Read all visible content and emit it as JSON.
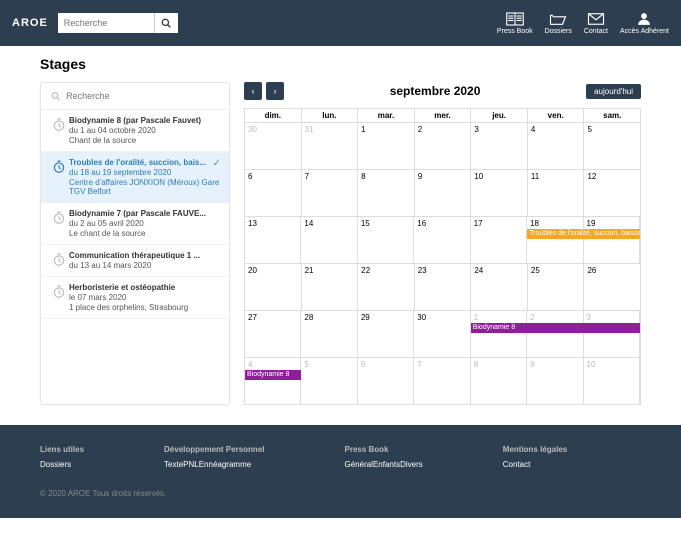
{
  "header": {
    "logo": "AROE",
    "search_placeholder": "Recherche",
    "nav": [
      {
        "label": "Press Book"
      },
      {
        "label": "Dossiers"
      },
      {
        "label": "Contact"
      },
      {
        "label": "Accès Adhérent"
      }
    ]
  },
  "page_title": "Stages",
  "side_search_placeholder": "Recherche",
  "events": [
    {
      "title": "Biodynamie 8 (par Pascale Fauvet)",
      "date": "du 1 au 04 octobre 2020",
      "loc": "Chant de la source",
      "sel": false
    },
    {
      "title": "Troubles de l'oralité, succion, bais...",
      "date": "du 18 au 19 septembre 2020",
      "loc": "Centre d'affaires JONXION (Méroux) Gare TGV Belfort",
      "sel": true
    },
    {
      "title": "Biodynamie 7 (par Pascale FAUVE...",
      "date": "du 2 au 05 avril 2020",
      "loc": "Le chant de la source",
      "sel": false
    },
    {
      "title": "Communication thérapeutique 1 ...",
      "date": "du 13 au 14 mars 2020",
      "loc": "",
      "sel": false
    },
    {
      "title": "Herboristerie et ostéopathie",
      "date": "le 07 mars 2020",
      "loc": "1 place des orphelins, Strasbourg",
      "sel": false
    }
  ],
  "calendar": {
    "title": "septembre 2020",
    "today_label": "aujourd'hui",
    "dow": [
      "dim.",
      "lun.",
      "mar.",
      "mer.",
      "jeu.",
      "ven.",
      "sam."
    ],
    "weeks": [
      [
        {
          "n": "30",
          "o": true
        },
        {
          "n": "31",
          "o": true
        },
        {
          "n": "1"
        },
        {
          "n": "2"
        },
        {
          "n": "3"
        },
        {
          "n": "4"
        },
        {
          "n": "5"
        }
      ],
      [
        {
          "n": "6"
        },
        {
          "n": "7"
        },
        {
          "n": "8"
        },
        {
          "n": "9"
        },
        {
          "n": "10"
        },
        {
          "n": "11"
        },
        {
          "n": "12"
        }
      ],
      [
        {
          "n": "13"
        },
        {
          "n": "14"
        },
        {
          "n": "15"
        },
        {
          "n": "16"
        },
        {
          "n": "17"
        },
        {
          "n": "18"
        },
        {
          "n": "19"
        }
      ],
      [
        {
          "n": "20"
        },
        {
          "n": "21"
        },
        {
          "n": "22"
        },
        {
          "n": "23"
        },
        {
          "n": "24"
        },
        {
          "n": "25"
        },
        {
          "n": "26"
        }
      ],
      [
        {
          "n": "27"
        },
        {
          "n": "28"
        },
        {
          "n": "29"
        },
        {
          "n": "30"
        },
        {
          "n": "1",
          "o": true
        },
        {
          "n": "2",
          "o": true
        },
        {
          "n": "3",
          "o": true
        }
      ],
      [
        {
          "n": "4",
          "o": true
        },
        {
          "n": "5",
          "o": true
        },
        {
          "n": "6",
          "o": true
        },
        {
          "n": "7",
          "o": true
        },
        {
          "n": "8",
          "o": true
        },
        {
          "n": "9",
          "o": true
        },
        {
          "n": "10",
          "o": true
        }
      ]
    ],
    "bars": [
      {
        "week": 2,
        "start": 5,
        "span": 2,
        "color": "#f5a623",
        "text": "Troubles de l'oralité, succion, baisse ou"
      },
      {
        "week": 4,
        "start": 4,
        "span": 3,
        "color": "#8e1e9a",
        "text": "Biodynamie 8"
      },
      {
        "week": 5,
        "start": 0,
        "span": 1,
        "color": "#8e1e9a",
        "text": "Biodynamie 8"
      }
    ]
  },
  "footer": {
    "cols": [
      {
        "title": "Liens utiles",
        "links": [
          "Dossiers"
        ],
        "heading_is_link": true
      },
      {
        "title": "Développement Personnel",
        "links": [
          "Texte",
          "PNL",
          "Ennéagramme"
        ]
      },
      {
        "title": "Press Book",
        "links": [
          "Général",
          "Enfants",
          "Divers"
        ]
      },
      {
        "title": "Mentions légales",
        "links": [
          "Contact"
        ],
        "heading_is_link": true
      }
    ],
    "copy": "© 2020 AROE Tous droits réservés."
  }
}
